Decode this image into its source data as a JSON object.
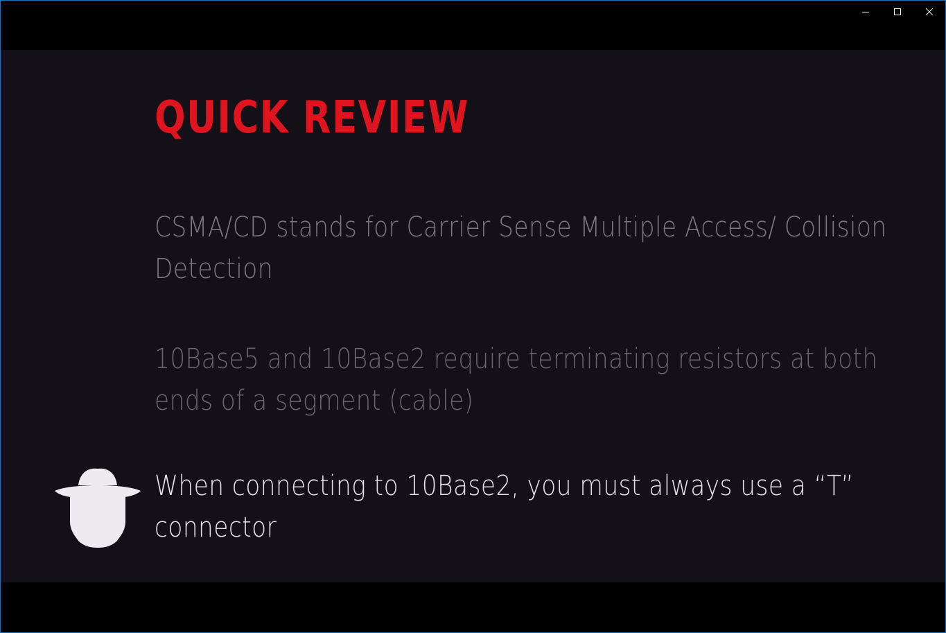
{
  "slide": {
    "title": "QUICK REVIEW",
    "points": [
      "CSMA/CD stands for Carrier Sense Multiple Access/ Collision Detection",
      "10Base5 and 10Base2 require terminating resistors at both ends of a segment (cable)",
      "When connecting to 10Base2, you must always use a “T” connector"
    ]
  },
  "icons": {
    "minimize": "minimize-icon",
    "maximize": "maximize-icon",
    "close": "close-icon",
    "marker": "spy-hat-icon"
  },
  "colors": {
    "title": "#e0141e",
    "slide_background": "#141017",
    "active_point": "#e6e3e6",
    "dim_point": "#7c787d"
  }
}
